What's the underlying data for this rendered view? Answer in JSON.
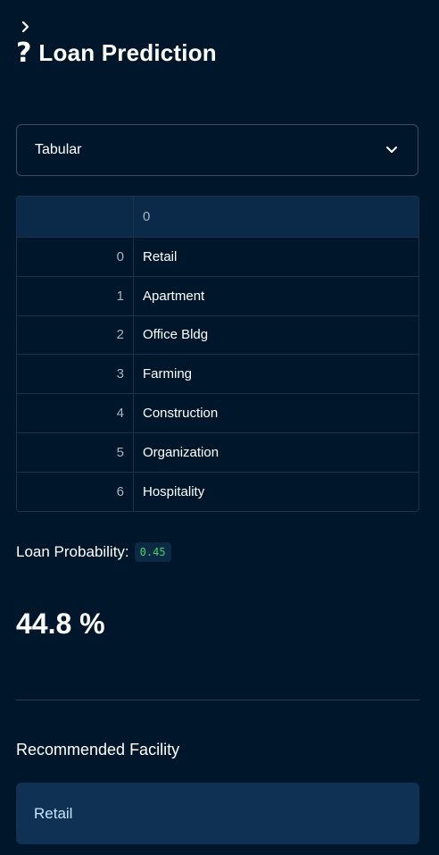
{
  "header": {
    "title": "Loan Prediction",
    "icon": "question-mark-icon"
  },
  "select": {
    "value": "Tabular"
  },
  "table": {
    "column_header": "0",
    "rows": [
      {
        "index": "0",
        "value": "Retail"
      },
      {
        "index": "1",
        "value": "Apartment"
      },
      {
        "index": "2",
        "value": "Office Bldg"
      },
      {
        "index": "3",
        "value": "Farming"
      },
      {
        "index": "4",
        "value": "Construction"
      },
      {
        "index": "5",
        "value": "Organization"
      },
      {
        "index": "6",
        "value": "Hospitality"
      }
    ]
  },
  "probability": {
    "label": "Loan Probability:",
    "code_value": "0.45",
    "metric": "44.8 %"
  },
  "recommendation": {
    "heading": "Recommended Facility",
    "value": "Retail"
  },
  "colors": {
    "background": "#00172b",
    "code_text": "#3dd56d",
    "info_bg": "#0f3153"
  }
}
